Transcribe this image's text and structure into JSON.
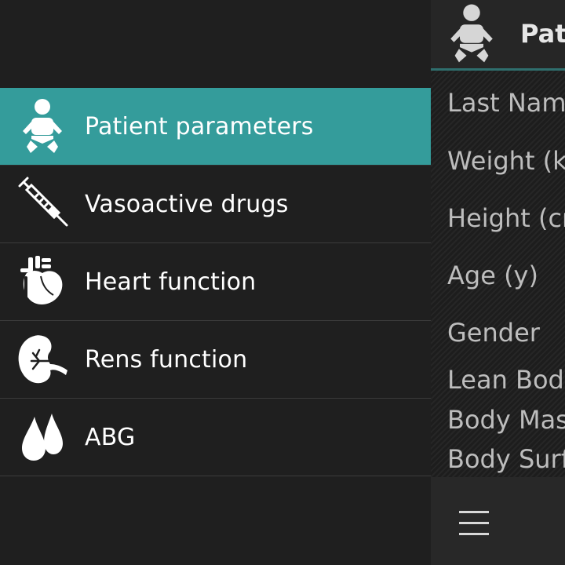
{
  "drawer": {
    "items": [
      {
        "label": "Patient parameters",
        "icon": "baby-icon",
        "active": true
      },
      {
        "label": "Vasoactive drugs",
        "icon": "syringe-icon",
        "active": false
      },
      {
        "label": "Heart function",
        "icon": "heart-icon",
        "active": false
      },
      {
        "label": "Rens function",
        "icon": "kidney-icon",
        "active": false
      },
      {
        "label": "ABG",
        "icon": "blood-drops-icon",
        "active": false
      }
    ]
  },
  "panel": {
    "title": "Pat",
    "header_icon": "baby-icon",
    "fields": [
      "Last Name",
      "Weight (k",
      "Height (cr",
      "Age (y)",
      "Gender",
      "Lean Body",
      "Body Mas",
      "Body Surf"
    ],
    "footer_icon": "menu-icon"
  },
  "colors": {
    "accent": "#349c9b",
    "background": "#1f1f1f",
    "divider": "#3b3b3b"
  }
}
